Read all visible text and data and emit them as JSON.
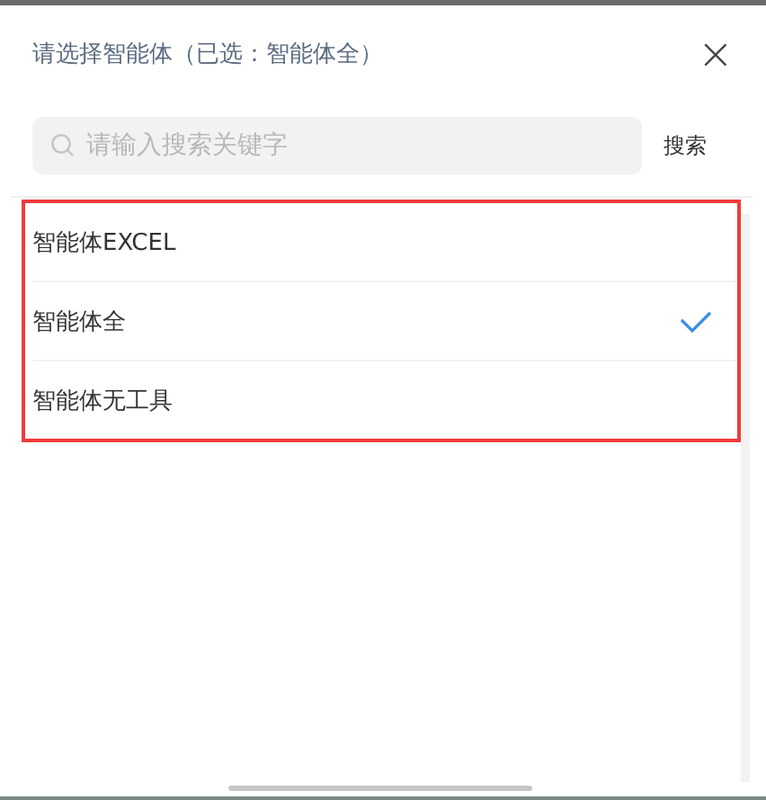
{
  "dialog": {
    "title": "请选择智能体（已选：智能体全）",
    "close_icon": "×"
  },
  "search": {
    "placeholder": "请输入搜索关键字",
    "button": "搜索"
  },
  "options": [
    {
      "label": "智能体EXCEL",
      "selected": false
    },
    {
      "label": "智能体全",
      "selected": true
    },
    {
      "label": "智能体无工具",
      "selected": false
    }
  ]
}
